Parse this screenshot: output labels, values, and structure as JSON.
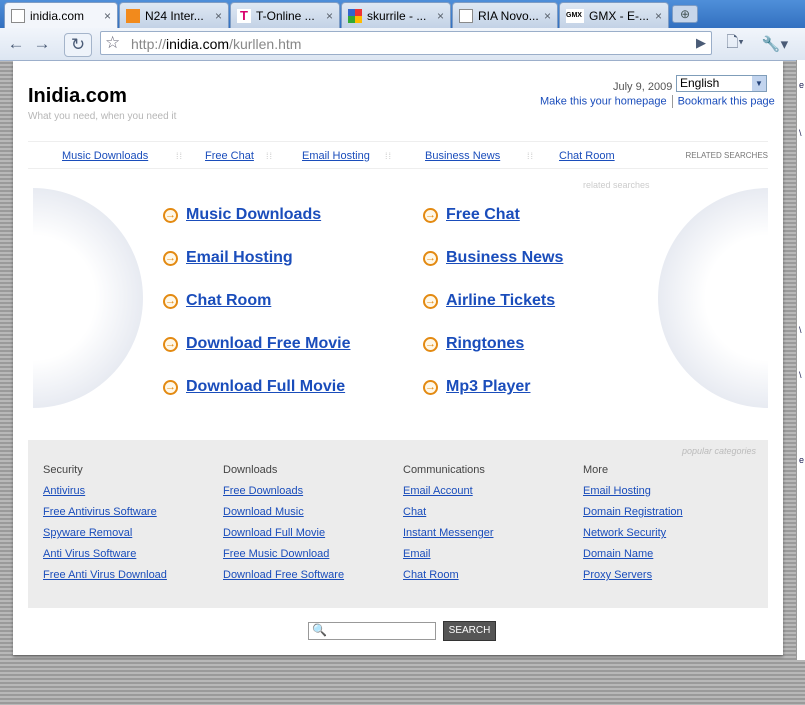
{
  "browser": {
    "tabs": [
      {
        "title": "inidia.com",
        "favicon": "page-icon"
      },
      {
        "title": "N24 Inter...",
        "favicon": "n24-icon"
      },
      {
        "title": "T-Online ...",
        "favicon": "telekom-icon"
      },
      {
        "title": "skurrile - ...",
        "favicon": "google-icon"
      },
      {
        "title": "RIA Novo...",
        "favicon": "page-icon"
      },
      {
        "title": "GMX - E-...",
        "favicon": "gmx-icon"
      }
    ],
    "close_glyph": "×",
    "url_prefix": "http://",
    "url_host": "inidia.com",
    "url_path": "/kurllen.htm"
  },
  "site": {
    "logo": "Inidia.com",
    "tagline": "What you need, when you need it",
    "date": "July 9, 2009",
    "language": "English",
    "make_homepage": "Make this your homepage",
    "bookmark": "Bookmark this page"
  },
  "related_bar": {
    "links": [
      "Music Downloads",
      "Free Chat",
      "Email Hosting",
      "Business News",
      "Chat Room"
    ],
    "label": "RELATED SEARCHES"
  },
  "related_searches": {
    "label": "related searches",
    "left": [
      "Music Downloads",
      "Email Hosting",
      "Chat Room",
      "Download Free Movie",
      "Download Full Movie"
    ],
    "right": [
      "Free Chat",
      "Business News",
      "Airline Tickets",
      "Ringtones",
      "Mp3 Player"
    ]
  },
  "popular": {
    "label": "popular categories",
    "columns": [
      {
        "heading": "Security",
        "links": [
          "Antivirus",
          "Free Antivirus Software",
          "Spyware Removal",
          "Anti Virus Software",
          "Free Anti Virus Download"
        ]
      },
      {
        "heading": "Downloads",
        "links": [
          "Free Downloads",
          "Download Music",
          "Download Full Movie",
          "Free Music Download",
          "Download Free Software"
        ]
      },
      {
        "heading": "Communications",
        "links": [
          "Email Account",
          "Chat",
          "Instant Messenger",
          "Email",
          "Chat Room"
        ]
      },
      {
        "heading": "More",
        "links": [
          "Email Hosting",
          "Domain Registration",
          "Network Security",
          "Domain Name",
          "Proxy Servers"
        ]
      }
    ]
  },
  "search": {
    "button": "SEARCH"
  }
}
